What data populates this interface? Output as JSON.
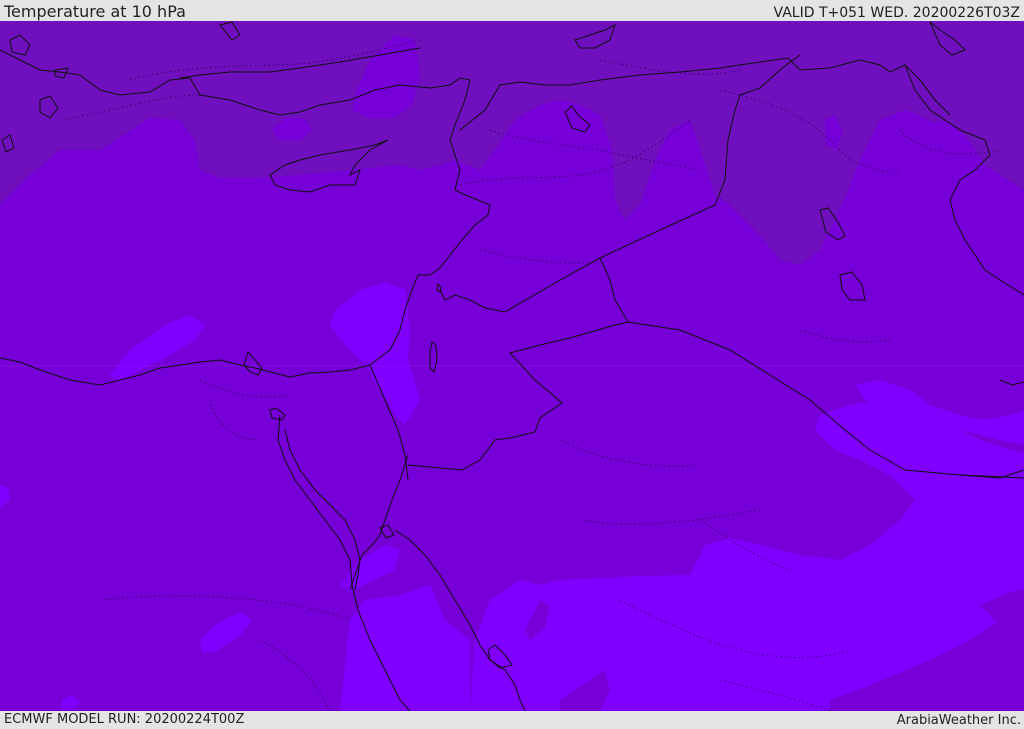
{
  "header": {
    "title": "Temperature at 10 hPa",
    "valid": "VALID T+051 WED. 20200226T03Z"
  },
  "footer": {
    "model_run": "ECMWF MODEL RUN: 20200224T00Z",
    "credit": "ArabiaWeather Inc."
  },
  "map": {
    "variable": "temperature",
    "level": "10 hPa",
    "colors": {
      "band_dark": "#6f0fbd",
      "band_mid": "#7700d8",
      "band_light": "#7f00ff",
      "border": "#111111"
    }
  }
}
